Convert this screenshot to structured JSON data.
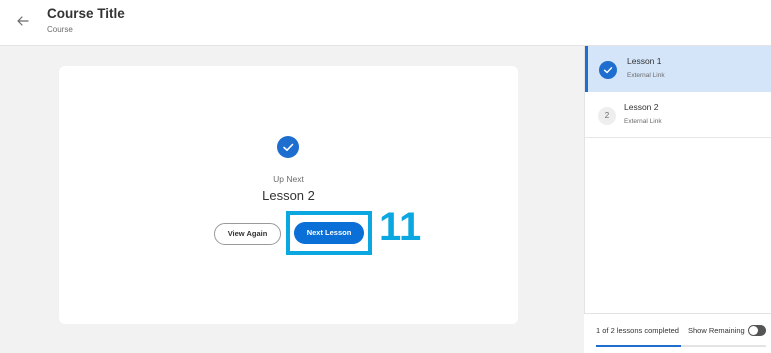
{
  "header": {
    "back_icon": "arrow-left-icon",
    "title": "Course Title",
    "subtitle": "Course"
  },
  "completion": {
    "check_icon": "check-circle-icon",
    "up_next_label": "Up Next",
    "next_lesson_title": "Lesson 2",
    "view_again_label": "View Again",
    "next_lesson_label": "Next Lesson"
  },
  "annotation": {
    "number": "11",
    "color": "#0aa7e0"
  },
  "sidebar": {
    "lessons": [
      {
        "title": "Lesson 1",
        "type": "External Link",
        "status": "completed",
        "icon": "check-circle-icon"
      },
      {
        "title": "Lesson 2",
        "type": "External Link",
        "status": "pending",
        "number": "2"
      }
    ],
    "progress_text": "1 of 2 lessons completed",
    "progress_fraction": 0.5,
    "show_remaining_label": "Show Remaining",
    "show_remaining_on": false
  },
  "colors": {
    "accent": "#1d6ecf",
    "primary_button": "#0a6fd6",
    "active_row": "#d4e5fa"
  }
}
